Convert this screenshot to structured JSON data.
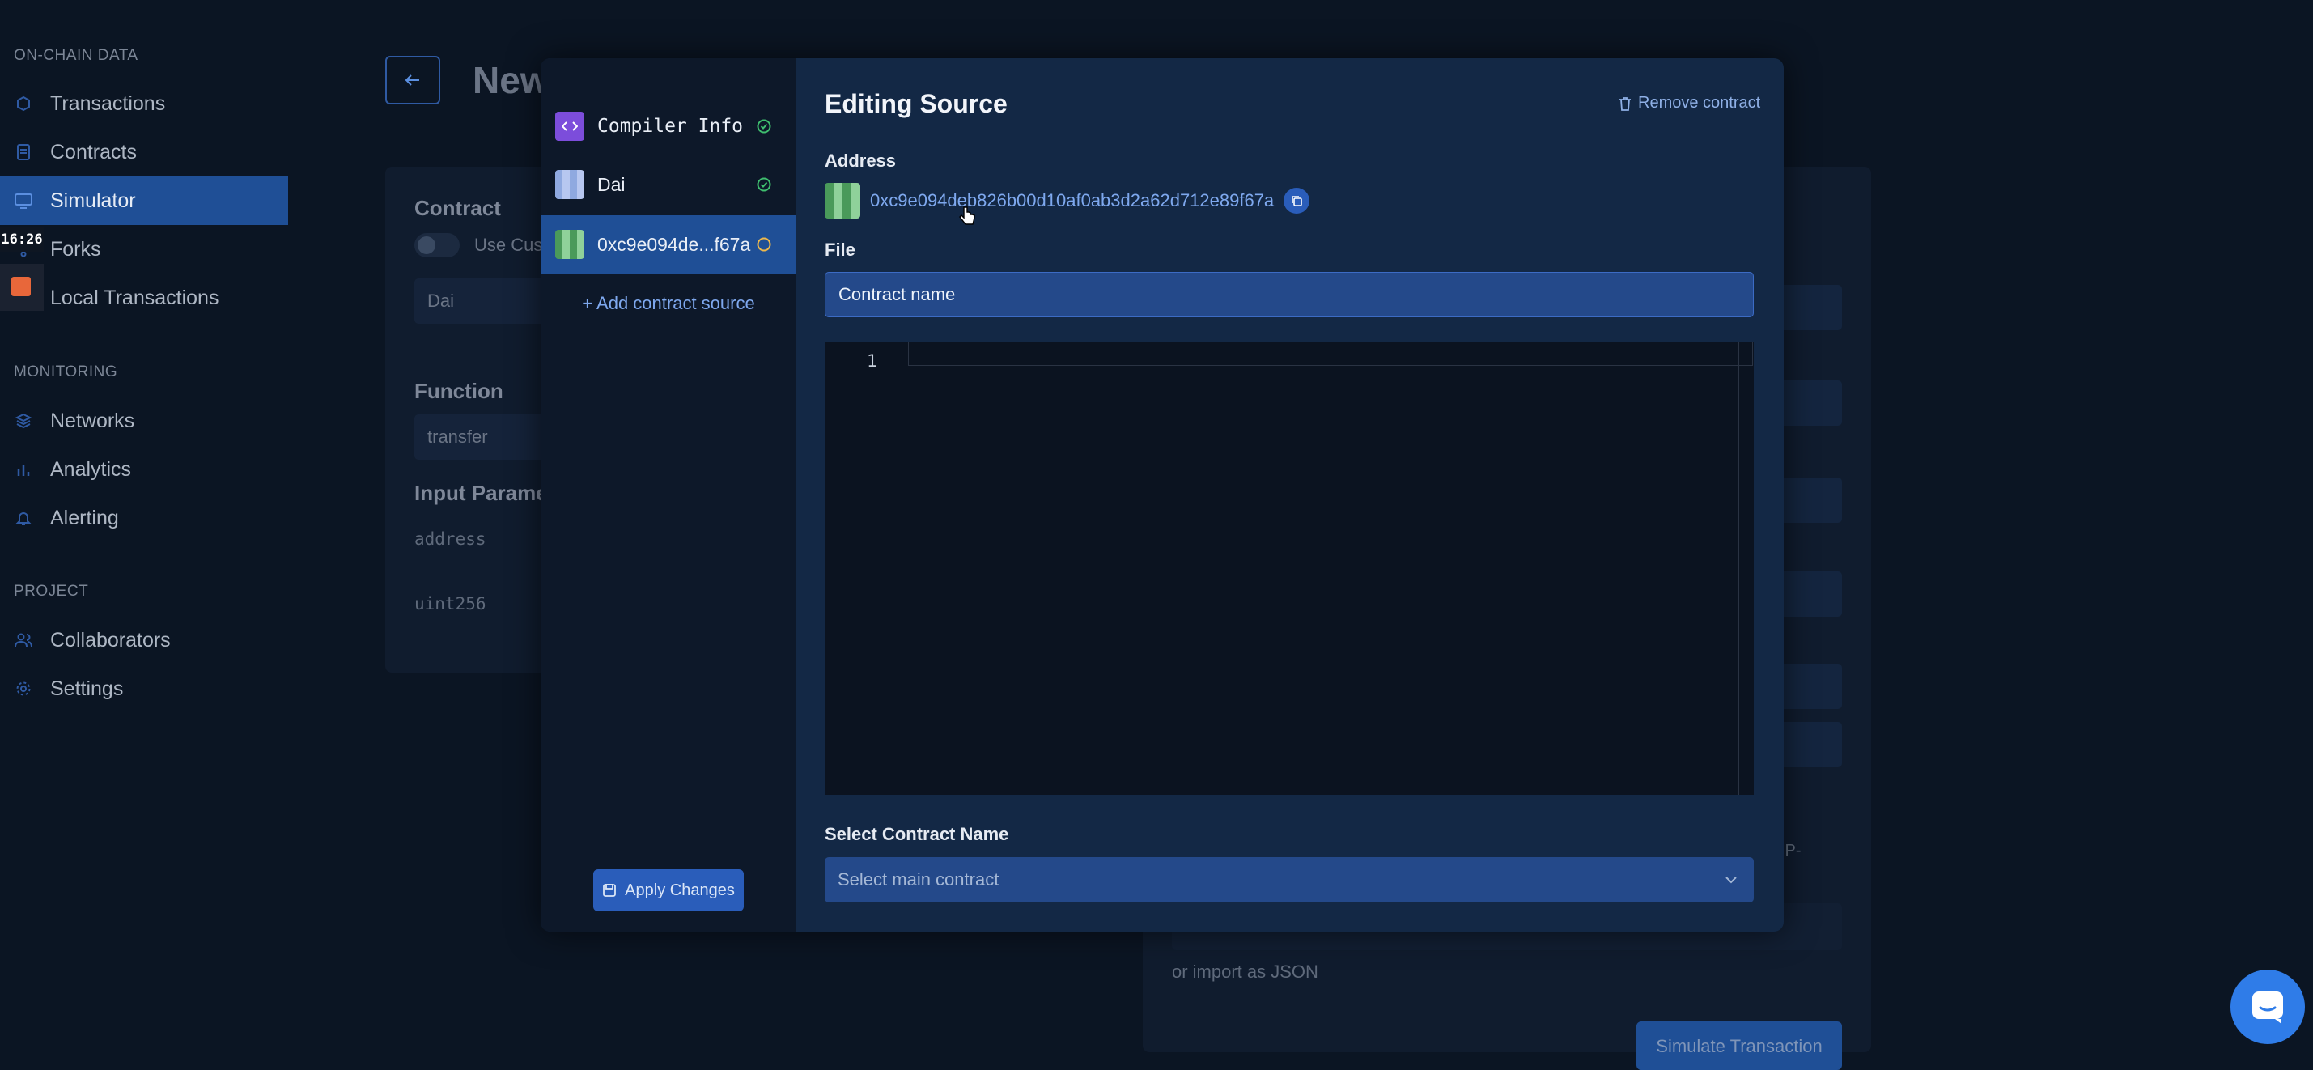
{
  "sidebar": {
    "sections": [
      {
        "label": "ON-CHAIN DATA",
        "items": [
          {
            "label": "Transactions",
            "icon": "cube-icon"
          },
          {
            "label": "Contracts",
            "icon": "document-icon"
          },
          {
            "label": "Simulator",
            "icon": "monitor-icon",
            "active": true
          },
          {
            "label": "Forks",
            "icon": "fork-icon"
          },
          {
            "label": "Local Transactions",
            "icon": "terminal-icon"
          }
        ]
      },
      {
        "label": "MONITORING",
        "items": [
          {
            "label": "Networks",
            "icon": "layers-icon"
          },
          {
            "label": "Analytics",
            "icon": "bar-chart-icon"
          },
          {
            "label": "Alerting",
            "icon": "bell-icon"
          }
        ]
      },
      {
        "label": "PROJECT",
        "items": [
          {
            "label": "Collaborators",
            "icon": "users-icon"
          },
          {
            "label": "Settings",
            "icon": "gear-icon"
          }
        ]
      }
    ]
  },
  "overlay": {
    "time": "16:26"
  },
  "background": {
    "page_title": "New",
    "contract_heading": "Contract",
    "use_custom_label": "Use Cus",
    "contract_value": "Dai",
    "function_heading": "Function",
    "function_value": "transfer",
    "input_params_heading": "Input Parame",
    "param_1": "address",
    "param_2": "uint256",
    "ip_label": "IP-",
    "add_address": "Add address to access list",
    "import_json": "or import as JSON",
    "simulate_button": "Simulate Transaction"
  },
  "modal": {
    "sources": [
      {
        "label": "Compiler Info",
        "status": "valid",
        "mono": true
      },
      {
        "label": "Dai",
        "status": "valid",
        "mono": false
      },
      {
        "label": "0xc9e094de...f67a",
        "status": "pending",
        "mono": false,
        "active": true
      }
    ],
    "add_source_label": "+ Add contract source",
    "apply_label": "Apply Changes",
    "title": "Editing Source",
    "remove_label": "Remove contract",
    "address_label": "Address",
    "address_value": "0xc9e094deb826b00d10af0ab3d2a62d712e89f67a",
    "file_label": "File",
    "file_value": "Contract name",
    "editor_line": "1",
    "select_label": "Select Contract Name",
    "select_placeholder": "Select main contract"
  },
  "colors": {
    "accent": "#1f4f96",
    "valid": "#3fbf6f",
    "pending": "#f0b94a"
  }
}
